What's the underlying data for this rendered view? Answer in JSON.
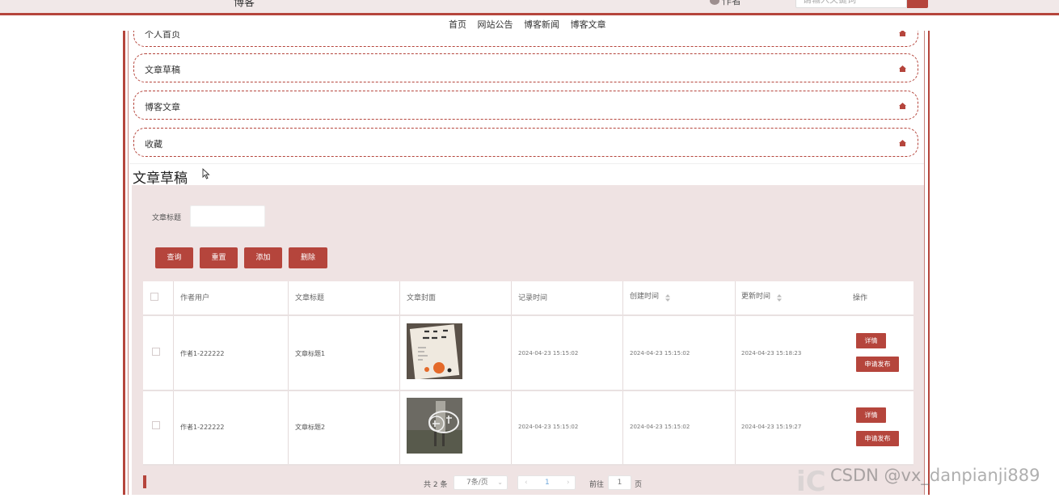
{
  "header": {
    "site_title_fragment": "博客",
    "user_name_fragment": "作者",
    "search_placeholder": "请输入关键词",
    "nav": [
      "首页",
      "网站公告",
      "博客新闻",
      "博客文章"
    ]
  },
  "menu": {
    "items": [
      {
        "label": "个人首页"
      },
      {
        "label": "文章草稿"
      },
      {
        "label": "博客文章"
      },
      {
        "label": "收藏"
      }
    ]
  },
  "page": {
    "title": "文章草稿"
  },
  "filter": {
    "label": "文章标题",
    "value": ""
  },
  "buttons": {
    "query": "查询",
    "reset": "重置",
    "add": "添加",
    "delete": "删除"
  },
  "table": {
    "headers": [
      "作者用户",
      "文章标题",
      "文章封面",
      "记录时间",
      "创建时间",
      "更新时间",
      "操作"
    ],
    "rows": [
      {
        "author": "作者1-222222",
        "title": "文章标题1",
        "cover": "book-cover",
        "record_time": "2024-04-23 15:15:02",
        "created_time": "2024-04-23 15:15:02",
        "updated_time": "2024-04-23 15:18:23"
      },
      {
        "author": "作者1-222222",
        "title": "文章标题2",
        "cover": "growth-photo",
        "record_time": "2024-04-23 15:15:02",
        "created_time": "2024-04-23 15:15:02",
        "updated_time": "2024-04-23 15:19:27"
      }
    ],
    "action_detail": "详情",
    "action_publish": "申请发布"
  },
  "pagination": {
    "total": "共 2 条",
    "page_size": "7条/页",
    "current_page": "1",
    "goto_label": "前往",
    "goto_value": "1",
    "page_unit": "页"
  },
  "watermark": "CSDN @vx_danpianji889",
  "colors": {
    "accent": "#b5453c",
    "panel_bg": "#efe3e3"
  }
}
